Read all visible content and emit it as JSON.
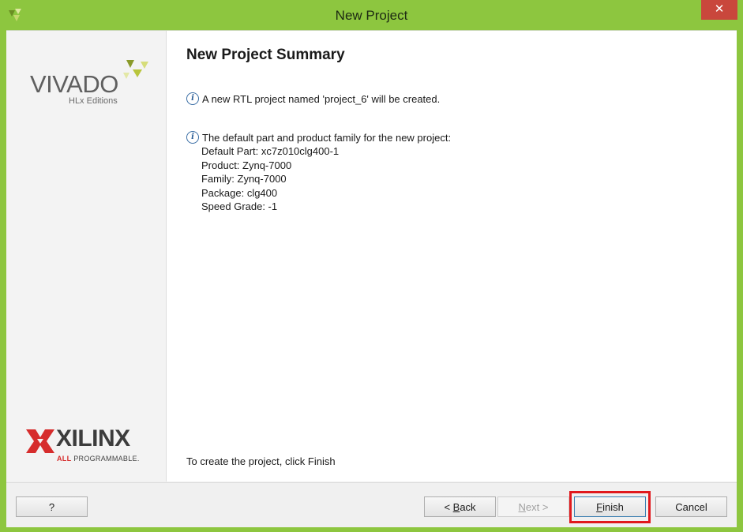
{
  "window": {
    "title": "New Project",
    "close_label": "✕"
  },
  "branding": {
    "vivado": "VIVADO",
    "vivado_sub": "HLx Editions",
    "xilinx": "XILINX",
    "all_programmable_prefix": "ALL",
    "all_programmable_suffix": "PROGRAMMABLE."
  },
  "summary": {
    "heading": "New Project Summary",
    "info1": "A new RTL project named 'project_6' will be created.",
    "info2": "The default part and product family for the new project:",
    "details": [
      "Default Part: xc7z010clg400-1",
      "Product: Zynq-7000",
      "Family: Zynq-7000",
      "Package: clg400",
      "Speed Grade: -1"
    ],
    "footer": "To create the project, click Finish"
  },
  "buttons": {
    "help": "?",
    "back_prefix": "< ",
    "back_mnemonic": "B",
    "back_rest": "ack",
    "next_mnemonic": "N",
    "next_rest": "ext >",
    "finish_mnemonic": "F",
    "finish_rest": "inish",
    "cancel": "Cancel"
  },
  "colors": {
    "frame": "#8dc63f",
    "highlight": "#e0191d",
    "close": "#c9473c"
  }
}
